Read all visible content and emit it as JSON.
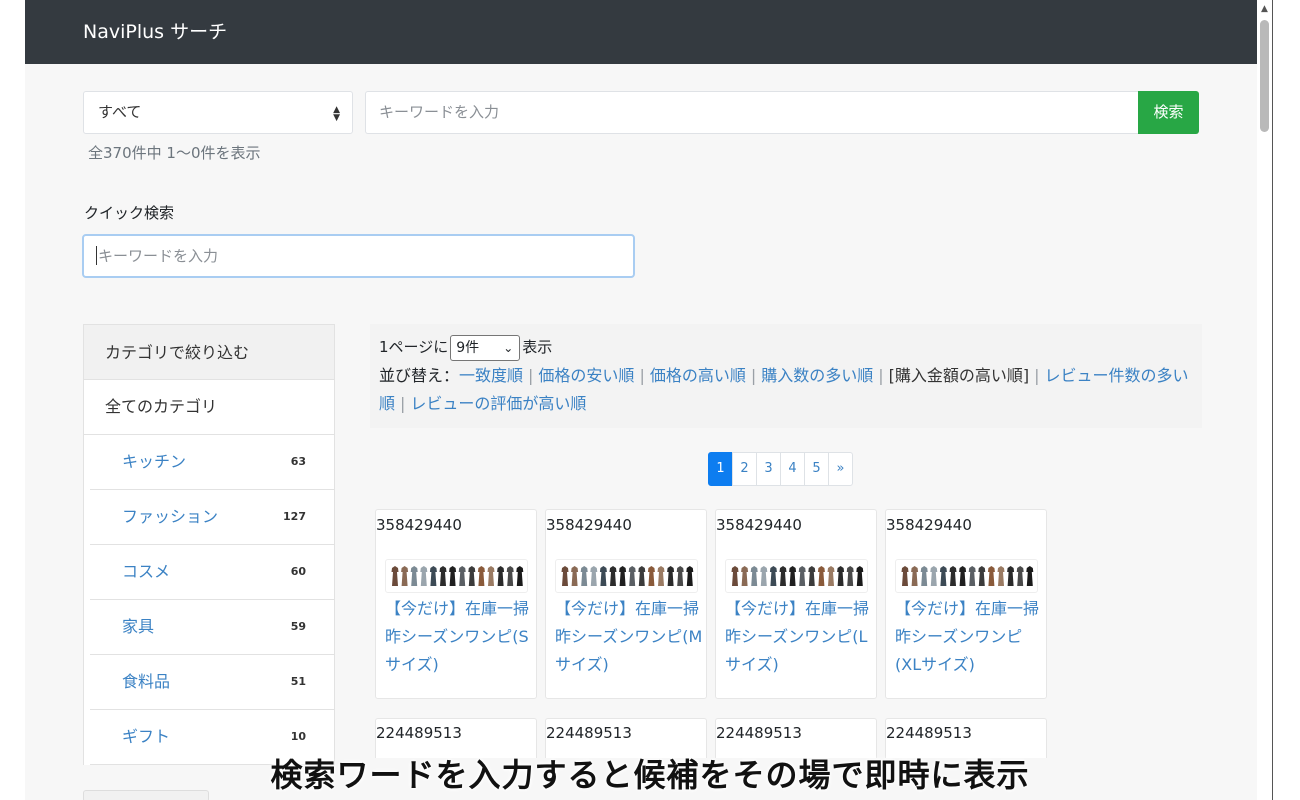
{
  "navbar": {
    "brand": "NaviPlus サーチ"
  },
  "search": {
    "category_selected": "すべて",
    "keyword_placeholder": "キーワードを入力",
    "button_label": "検索",
    "result_count": "全370件中 1〜0件を表示"
  },
  "quick_search": {
    "label": "クイック検索",
    "placeholder": "キーワードを入力"
  },
  "sidebar": {
    "title": "カテゴリで絞り込む",
    "all_label": "全てのカテゴリ",
    "items": [
      {
        "label": "キッチン",
        "count": "63"
      },
      {
        "label": "ファッション",
        "count": "127"
      },
      {
        "label": "コスメ",
        "count": "60"
      },
      {
        "label": "家具",
        "count": "59"
      },
      {
        "label": "食料品",
        "count": "51"
      },
      {
        "label": "ギフト",
        "count": "10"
      }
    ]
  },
  "listing": {
    "perpage_prefix": "1ページに",
    "perpage_value": "9件",
    "perpage_suffix": "表示",
    "sort_label": "並び替え：",
    "sort_options": [
      {
        "label": "一致度順",
        "active": false
      },
      {
        "label": "価格の安い順",
        "active": false
      },
      {
        "label": "価格の高い順",
        "active": false
      },
      {
        "label": "購入数の多い順",
        "active": false
      },
      {
        "label": "[購入金額の高い順]",
        "active": true
      },
      {
        "label": "レビュー件数の多い順",
        "active": false
      },
      {
        "label": "レビューの評価が高い順",
        "active": false
      }
    ],
    "pagination": [
      "1",
      "2",
      "3",
      "4",
      "5",
      "»"
    ],
    "current_page": "1"
  },
  "products": [
    {
      "id": "358429440",
      "title": "【今だけ】在庫一掃昨シーズンワンピ(Sサイズ)"
    },
    {
      "id": "358429440",
      "title": "【今だけ】在庫一掃昨シーズンワンピ(Mサイズ)"
    },
    {
      "id": "358429440",
      "title": "【今だけ】在庫一掃昨シーズンワンピ(Lサイズ)"
    },
    {
      "id": "358429440",
      "title": "【今だけ】在庫一掃昨シーズンワンピ(XLサイズ)"
    }
  ],
  "products_row2": [
    {
      "id": "224489513"
    },
    {
      "id": "224489513"
    },
    {
      "id": "224489513"
    },
    {
      "id": "224489513"
    }
  ],
  "thumbnail_colors": [
    "#6b4a3a",
    "#8a6a55",
    "#7b8a94",
    "#9aa5ad",
    "#3c4a55",
    "#2c2c2c",
    "#1f1f1f",
    "#5a5f64",
    "#3b3b3b",
    "#8a5a3a",
    "#9a7a62",
    "#2a2a2a",
    "#4a4a4a",
    "#1a1a1a"
  ],
  "caption": "検索ワードを入力すると候補をその場で即時に表示"
}
